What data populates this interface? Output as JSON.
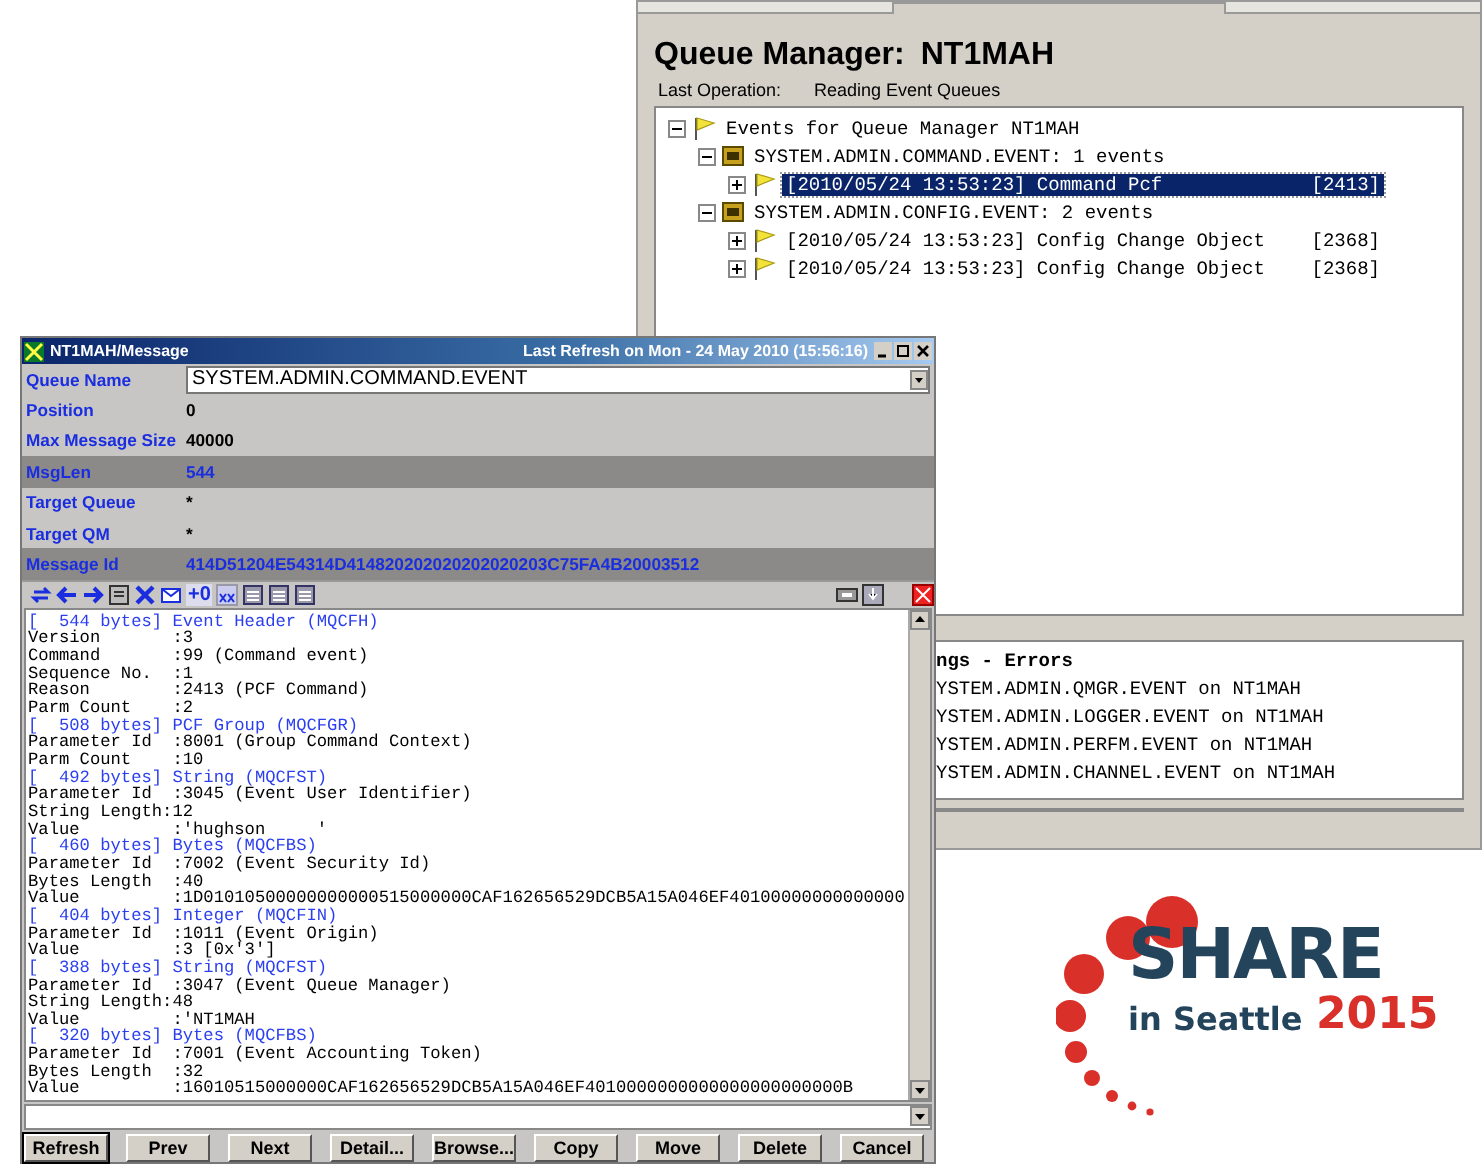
{
  "queue_manager_window": {
    "title": "Queue Manager:",
    "manager": "NT1MAH",
    "last_operation_label": "Last Operation:",
    "last_operation": "Reading Event Queues",
    "tree": [
      {
        "kind": "root",
        "label": "Events for Queue Manager NT1MAH",
        "expanded": true,
        "selected": false,
        "children": [
          {
            "kind": "queue",
            "label": "SYSTEM.ADMIN.COMMAND.EVENT: 1 events",
            "expanded": true,
            "selected": false,
            "children": [
              {
                "kind": "event",
                "label": "[2010/05/24 13:53:23] Command Pcf",
                "code": "[2413]",
                "expanded": false,
                "selected": true
              }
            ]
          },
          {
            "kind": "queue",
            "label": "SYSTEM.ADMIN.CONFIG.EVENT: 2 events",
            "expanded": true,
            "selected": false,
            "children": [
              {
                "kind": "event",
                "label": "[2010/05/24 13:53:23] Config Change Object",
                "code": "[2368]",
                "expanded": false,
                "selected": false
              },
              {
                "kind": "event",
                "label": "[2010/05/24 13:53:23] Config Change Object",
                "code": "[2368]",
                "expanded": false,
                "selected": false
              }
            ]
          }
        ]
      }
    ],
    "errors": [
      "ngs - Errors",
      "YSTEM.ADMIN.QMGR.EVENT on NT1MAH",
      "YSTEM.ADMIN.LOGGER.EVENT on NT1MAH",
      "YSTEM.ADMIN.PERFM.EVENT on NT1MAH",
      "YSTEM.ADMIN.CHANNEL.EVENT on NT1MAH"
    ]
  },
  "message_window": {
    "title": "NT1MAH/Message",
    "last_refresh": "Last Refresh on Mon - 24 May 2010 (15:56:16)",
    "fields": [
      {
        "kind": "combo",
        "label": "Queue Name",
        "value": "SYSTEM.ADMIN.COMMAND.EVENT",
        "highlighted": false
      },
      {
        "kind": "text",
        "label": "Position",
        "value": "0",
        "highlighted": false
      },
      {
        "kind": "text",
        "label": "Max Message Size",
        "value": "40000",
        "highlighted": false
      },
      {
        "kind": "text",
        "label": "MsgLen",
        "value": "544",
        "highlighted": true
      },
      {
        "kind": "text",
        "label": "Target Queue",
        "value": "*",
        "highlighted": false
      },
      {
        "kind": "text",
        "label": "Target QM",
        "value": "*",
        "highlighted": false
      },
      {
        "kind": "text",
        "label": "Message Id",
        "value": "414D51204E54314D414820202020202020203C75FA4B20003512",
        "highlighted": true
      }
    ],
    "toolbar_text": "+0",
    "lines": [
      {
        "kind": "header",
        "text": "[  544 bytes] Event Header (MQCFH)"
      },
      {
        "kind": "field",
        "text": "Version       :3"
      },
      {
        "kind": "field",
        "text": "Command       :99 (Command event)"
      },
      {
        "kind": "field",
        "text": "Sequence No.  :1"
      },
      {
        "kind": "field",
        "text": "Reason        :2413 (PCF Command)"
      },
      {
        "kind": "field",
        "text": "Parm Count    :2"
      },
      {
        "kind": "header",
        "text": "[  508 bytes] PCF Group (MQCFGR)"
      },
      {
        "kind": "field",
        "text": "Parameter Id  :8001 (Group Command Context)"
      },
      {
        "kind": "field",
        "text": "Parm Count    :10"
      },
      {
        "kind": "header",
        "text": "[  492 bytes] String (MQCFST)"
      },
      {
        "kind": "field",
        "text": "Parameter Id  :3045 (Event User Identifier)"
      },
      {
        "kind": "field",
        "text": "String Length:12"
      },
      {
        "kind": "field",
        "text": "Value         :'hughson     '"
      },
      {
        "kind": "header",
        "text": "[  460 bytes] Bytes (MQCFBS)"
      },
      {
        "kind": "field",
        "text": "Parameter Id  :7002 (Event Security Id)"
      },
      {
        "kind": "field",
        "text": "Bytes Length  :40"
      },
      {
        "kind": "field",
        "text": "Value         :1D01010500000000000515000000CAF162656529DCB5A15A046EF40100000000000000"
      },
      {
        "kind": "header",
        "text": "[  404 bytes] Integer (MQCFIN)"
      },
      {
        "kind": "field",
        "text": "Parameter Id  :1011 (Event Origin)"
      },
      {
        "kind": "field",
        "text": "Value         :3 [0x'3']"
      },
      {
        "kind": "header",
        "text": "[  388 bytes] String (MQCFST)"
      },
      {
        "kind": "field",
        "text": "Parameter Id  :3047 (Event Queue Manager)"
      },
      {
        "kind": "field",
        "text": "String Length:48"
      },
      {
        "kind": "field",
        "text": "Value         :'NT1MAH"
      },
      {
        "kind": "header",
        "text": "[  320 bytes] Bytes (MQCFBS)"
      },
      {
        "kind": "field",
        "text": "Parameter Id  :7001 (Event Accounting Token)"
      },
      {
        "kind": "field",
        "text": "Bytes Length  :32"
      },
      {
        "kind": "field",
        "text": "Value         :16010515000000CAF162656529DCB5A15A046EF4010000000000000000000000B"
      }
    ],
    "buttons": [
      {
        "label": "Refresh",
        "default": true
      },
      {
        "label": "Prev",
        "default": false
      },
      {
        "label": "Next",
        "default": false
      },
      {
        "label": "Detail...",
        "default": false
      },
      {
        "label": "Browse...",
        "default": false
      },
      {
        "label": "Copy",
        "default": false
      },
      {
        "label": "Move",
        "default": false
      },
      {
        "label": "Delete",
        "default": false
      },
      {
        "label": "Cancel",
        "default": false
      }
    ]
  },
  "logo": {
    "word": "SHARE",
    "place": "in Seattle",
    "year": "2015"
  }
}
